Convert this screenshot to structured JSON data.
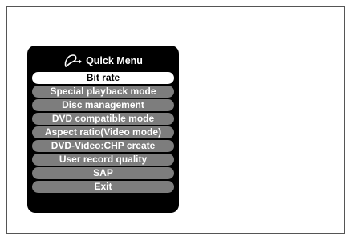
{
  "menu": {
    "title": "Quick Menu",
    "icon": "remote-hand-icon",
    "selected_index": 0,
    "items": [
      {
        "label": "Bit rate"
      },
      {
        "label": "Special playback mode"
      },
      {
        "label": "Disc management"
      },
      {
        "label": "DVD compatible mode"
      },
      {
        "label": "Aspect ratio(Video mode)"
      },
      {
        "label": "DVD-Video:CHP create"
      },
      {
        "label": "User record quality"
      },
      {
        "label": "SAP"
      },
      {
        "label": "Exit"
      }
    ]
  },
  "colors": {
    "menu_background": "#000000",
    "item_background": "#7d7d7d",
    "selected_background": "#ffffff",
    "item_text": "#ffffff",
    "selected_text": "#000000"
  }
}
